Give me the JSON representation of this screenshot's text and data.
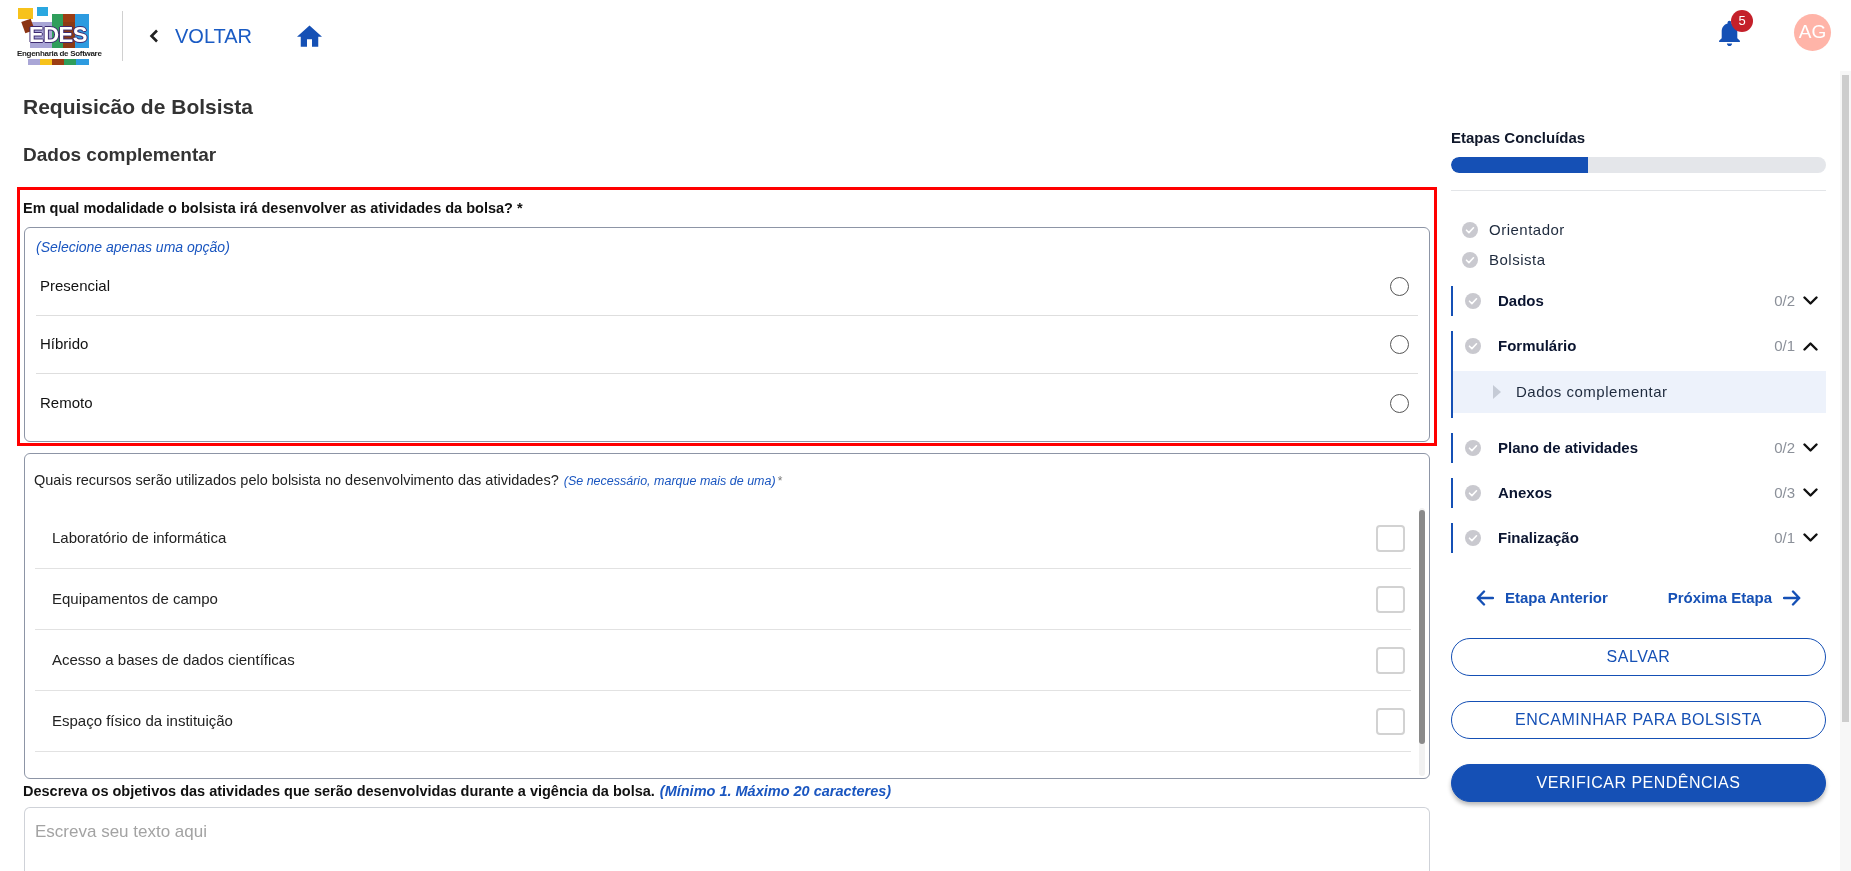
{
  "header": {
    "logo": {
      "title": "EDES",
      "subtitle": "Engenharia de Software"
    },
    "back_link": "VOLTAR",
    "notifications": {
      "count": "5"
    },
    "avatar": {
      "initials": "AG"
    }
  },
  "page": {
    "title": "Requisicão de Bolsista",
    "section_title": "Dados complementar"
  },
  "questions": [
    {
      "kind": "radio",
      "highlighted": true,
      "label": "Em qual modalidade o bolsista irá desenvolver as atividades da bolsa? *",
      "hint": "(Selecione apenas uma opção)",
      "options": [
        {
          "label": "Presencial",
          "selected": false
        },
        {
          "label": "Híbrido",
          "selected": false
        },
        {
          "label": "Remoto",
          "selected": false
        }
      ]
    },
    {
      "kind": "checkbox",
      "label": "Quais recursos serão utilizados pelo bolsista no desenvolvimento das atividades?",
      "hint": "(Se necessário, marque mais de uma)",
      "required_mark": "*",
      "options": [
        {
          "label": "Laboratório de informática",
          "checked": false
        },
        {
          "label": "Equipamentos de campo",
          "checked": false
        },
        {
          "label": "Acesso a bases de dados científicas",
          "checked": false
        },
        {
          "label": "Espaço físico da instituição",
          "checked": false
        }
      ]
    },
    {
      "kind": "text",
      "label": "Descreva os objetivos das atividades que serão desenvolvidas durante a vigência da bolsa.",
      "hint": "(Mínimo 1. Máximo 20 caracteres)",
      "placeholder": "Escreva seu texto aqui"
    }
  ],
  "sidebar": {
    "progress": {
      "title": "Etapas Concluídas",
      "level": 0.365
    },
    "completed": [
      {
        "label": "Orientador"
      },
      {
        "label": "Bolsista"
      }
    ],
    "sections": [
      {
        "label": "Dados",
        "count": "0/2",
        "expanded": false
      },
      {
        "label": "Formulário",
        "count": "0/1",
        "expanded": true,
        "children": [
          {
            "label": "Dados complementar",
            "selected": true
          }
        ]
      },
      {
        "label": "Plano de atividades",
        "count": "0/2",
        "expanded": false
      },
      {
        "label": "Anexos",
        "count": "0/3",
        "expanded": false
      },
      {
        "label": "Finalização",
        "count": "0/1",
        "expanded": false
      }
    ],
    "nav": {
      "previous": "Etapa Anterior",
      "next": "Próxima Etapa"
    },
    "buttons": [
      {
        "label": "SALVAR",
        "kind": "outline"
      },
      {
        "label": "ENCAMINHAR PARA BOLSISTA",
        "kind": "outline"
      },
      {
        "label": "VERIFICAR PENDÊNCIAS",
        "kind": "primary"
      }
    ]
  }
}
